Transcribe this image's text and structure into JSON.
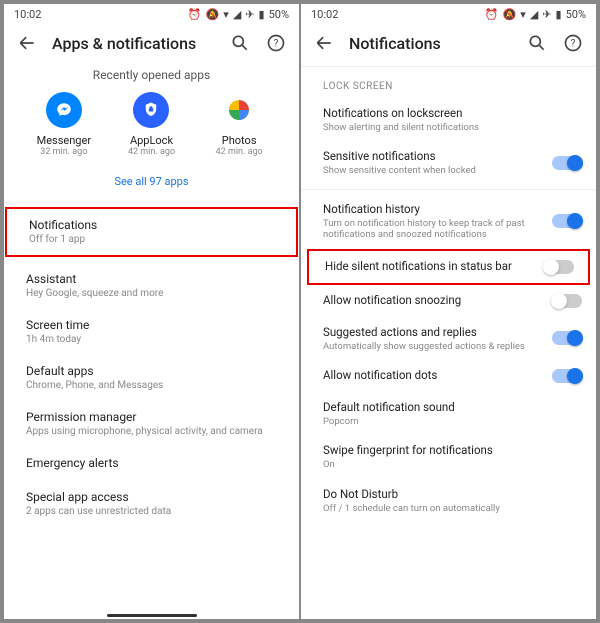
{
  "status": {
    "time": "10:02",
    "battery": "50%"
  },
  "left": {
    "title": "Apps & notifications",
    "recently_label": "Recently opened apps",
    "apps": [
      {
        "name": "Messenger",
        "sub": "32 min. ago"
      },
      {
        "name": "AppLock",
        "sub": "42 min. ago"
      },
      {
        "name": "Photos",
        "sub": "42 min. ago"
      }
    ],
    "see_all": "See all 97 apps",
    "rows": [
      {
        "label": "Notifications",
        "sub": "Off for 1 app"
      },
      {
        "label": "Assistant",
        "sub": "Hey Google, squeeze and more"
      },
      {
        "label": "Screen time",
        "sub": "1h 4m today"
      },
      {
        "label": "Default apps",
        "sub": "Chrome, Phone, and Messages"
      },
      {
        "label": "Permission manager",
        "sub": "Apps using microphone, physical activity, and camera"
      },
      {
        "label": "Emergency alerts",
        "sub": ""
      },
      {
        "label": "Special app access",
        "sub": "2 apps can use unrestricted data"
      }
    ]
  },
  "right": {
    "title": "Notifications",
    "section": "LOCK SCREEN",
    "rows": [
      {
        "label": "Notifications on lockscreen",
        "sub": "Show alerting and silent notifications",
        "toggle": null
      },
      {
        "label": "Sensitive notifications",
        "sub": "Show sensitive content when locked",
        "toggle": "on"
      },
      {
        "label": "Notification history",
        "sub": "Turn on notification history to keep track of past notifications and snoozed notifications",
        "toggle": "on"
      },
      {
        "label": "Hide silent notifications in status bar",
        "sub": "",
        "toggle": "off"
      },
      {
        "label": "Allow notification snoozing",
        "sub": "",
        "toggle": "off"
      },
      {
        "label": "Suggested actions and replies",
        "sub": "Automatically show suggested actions & replies",
        "toggle": "on"
      },
      {
        "label": "Allow notification dots",
        "sub": "",
        "toggle": "on"
      },
      {
        "label": "Default notification sound",
        "sub": "Popcorn",
        "toggle": null
      },
      {
        "label": "Swipe fingerprint for notifications",
        "sub": "On",
        "toggle": null
      },
      {
        "label": "Do Not Disturb",
        "sub": "Off / 1 schedule can turn on automatically",
        "toggle": null
      }
    ]
  }
}
